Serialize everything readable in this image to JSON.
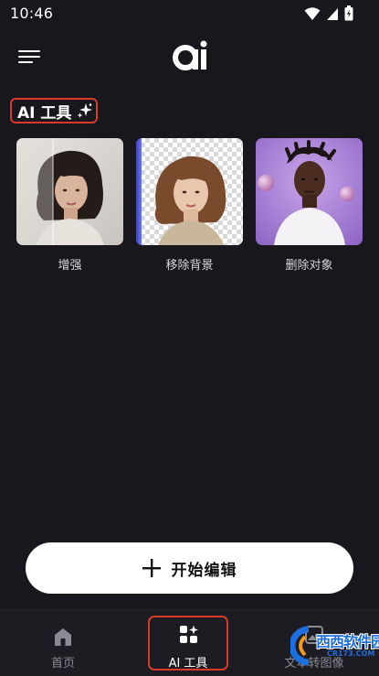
{
  "status_bar": {
    "time": "10:46"
  },
  "header": {
    "logo_text": "ai"
  },
  "section": {
    "title": "AI 工具"
  },
  "tools": [
    {
      "label": "增强"
    },
    {
      "label": "移除背景"
    },
    {
      "label": "删除对象"
    }
  ],
  "start_button": {
    "label": "开始编辑"
  },
  "bottom_nav": {
    "items": [
      {
        "label": "首页",
        "icon": "home-icon"
      },
      {
        "label": "AI 工具",
        "icon": "ai-tools-icon",
        "active": true
      },
      {
        "label": "文本转图像",
        "icon": "text-to-image-icon"
      }
    ]
  },
  "watermark": {
    "brand": "西西软件园",
    "url": "CR173.COM"
  },
  "colors": {
    "background": "#17171d",
    "highlight": "#d63a2a",
    "accent": "#ffffff"
  }
}
